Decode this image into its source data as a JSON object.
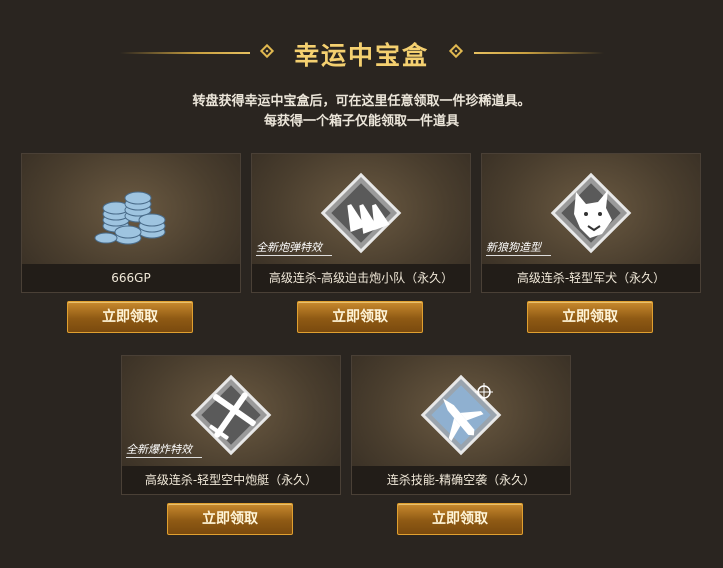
{
  "header": {
    "title": "幸运中宝盒",
    "line1": "转盘获得幸运中宝盒后，可在这里任意领取一件珍稀道具。",
    "line2": "每获得一个箱子仅能领取一件道具"
  },
  "items": [
    {
      "label": "666GP",
      "tag": "",
      "icon": "coins-icon",
      "button": "立即领取"
    },
    {
      "label": "高级连杀-高级迫击炮小队（永久）",
      "tag": "全新炮弹特效",
      "icon": "mortar-shells-icon",
      "button": "立即领取"
    },
    {
      "label": "高级连杀-轻型军犬（永久）",
      "tag": "新狼狗造型",
      "icon": "wolf-dog-icon",
      "button": "立即领取"
    },
    {
      "label": "高级连杀-轻型空中炮艇（永久）",
      "tag": "全新爆炸特效",
      "icon": "gunship-plane-icon",
      "button": "立即领取"
    },
    {
      "label": "连杀技能-精确空袭（永久）",
      "tag": "",
      "icon": "jet-airstrike-icon",
      "button": "立即领取"
    }
  ],
  "colors": {
    "accent": "#f4d070",
    "background": "#2a2520",
    "button": "#a86c1e"
  }
}
